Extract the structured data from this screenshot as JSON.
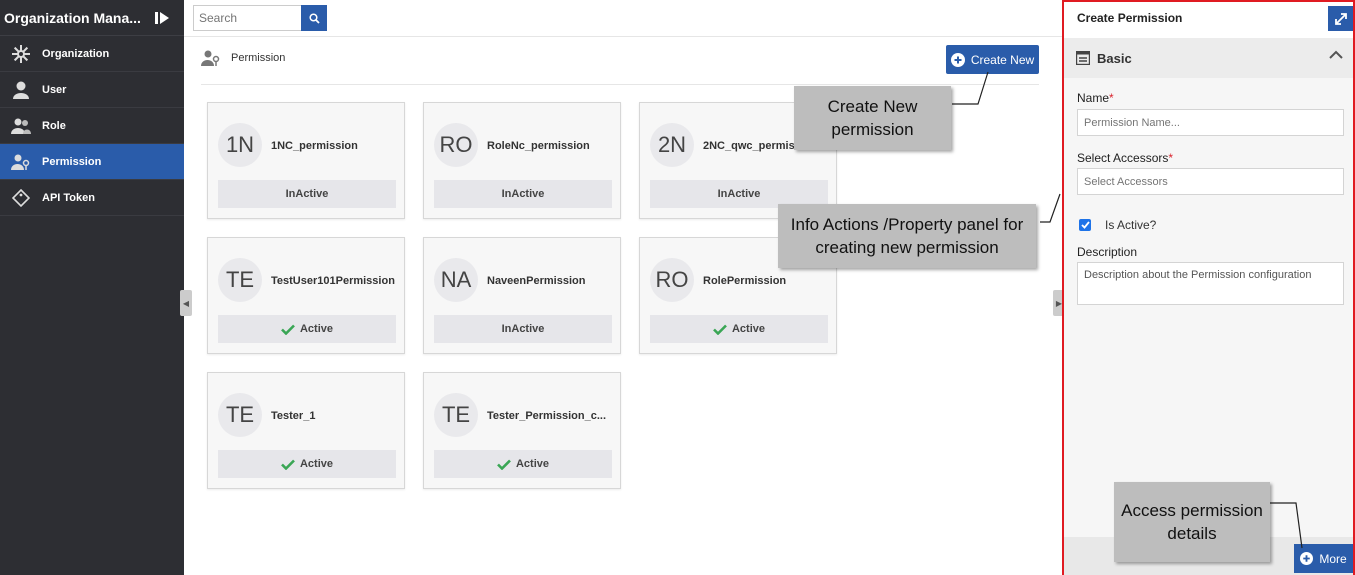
{
  "sidebar": {
    "title": "Organization Mana...",
    "items": [
      {
        "label": "Organization",
        "icon": "gear-icon"
      },
      {
        "label": "User",
        "icon": "user-icon"
      },
      {
        "label": "Role",
        "icon": "users-icon"
      },
      {
        "label": "Permission",
        "icon": "user-key-icon",
        "active": true
      },
      {
        "label": "API Token",
        "icon": "tag-icon"
      }
    ]
  },
  "search": {
    "placeholder": "Search"
  },
  "section": {
    "title": "Permission"
  },
  "create_button": "Create New",
  "cards": [
    {
      "initials": "1N",
      "name": "1NC_permission",
      "status": "InActive",
      "active": false
    },
    {
      "initials": "RO",
      "name": "RoleNc_permission",
      "status": "InActive",
      "active": false
    },
    {
      "initials": "2N",
      "name": "2NC_qwc_permission",
      "status": "InActive",
      "active": false
    },
    {
      "initials": "TE",
      "name": "TestUser101Permission",
      "status": "Active",
      "active": true
    },
    {
      "initials": "NA",
      "name": "NaveenPermission",
      "status": "InActive",
      "active": false
    },
    {
      "initials": "RO",
      "name": "RolePermission",
      "status": "Active",
      "active": true
    },
    {
      "initials": "TE",
      "name": "Tester_1",
      "status": "Active",
      "active": true
    },
    {
      "initials": "TE",
      "name": "Tester_Permission_c...",
      "status": "Active",
      "active": true
    }
  ],
  "callouts": {
    "create": "Create New permission",
    "panel": "Info Actions /Property panel for creating new permission",
    "access": "Access permission details"
  },
  "panel": {
    "title": "Create Permission",
    "section": "Basic",
    "name_label": "Name",
    "name_placeholder": "Permission Name...",
    "accessors_label": "Select Accessors",
    "accessors_placeholder": "Select Accessors",
    "active_label": "Is Active?",
    "description_label": "Description",
    "description_placeholder": "Description about the Permission configuration",
    "more_button": "More"
  },
  "colors": {
    "accent": "#2a5caa",
    "sidebar": "#2d2e33",
    "highlight": "#e01b22",
    "active_check": "#3aa655"
  }
}
